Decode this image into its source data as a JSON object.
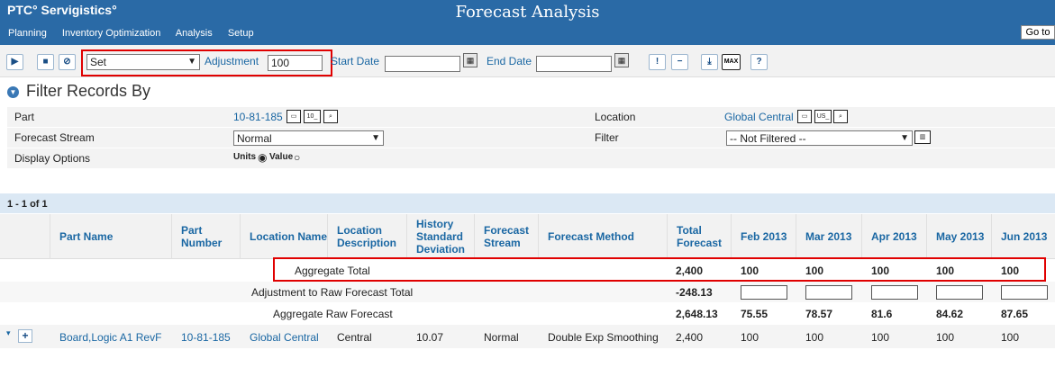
{
  "header": {
    "logo": "PTC° Servigistics°",
    "title": "Forecast Analysis",
    "menu": [
      "Planning",
      "Inventory Optimization",
      "Analysis",
      "Setup"
    ],
    "goto_label": "Go to"
  },
  "toolbar": {
    "mode_value": "Set",
    "adjustment_label": "Adjustment",
    "adjustment_value": "100",
    "start_date_label": "Start Date",
    "start_date_value": "",
    "end_date_label": "End Date",
    "end_date_value": "",
    "max_label": "MAX",
    "help_label": "?"
  },
  "filter": {
    "title": "Filter Records By",
    "part_label": "Part",
    "part_value": "10-81-185",
    "part_icon_text": "10_",
    "location_label": "Location",
    "location_value": "Global Central",
    "location_icon_text": "US_",
    "forecast_stream_label": "Forecast Stream",
    "forecast_stream_value": "Normal",
    "filter_label": "Filter",
    "filter_value": "-- Not Filtered --",
    "display_options_label": "Display Options",
    "units_label": "Units",
    "value_label": "Value"
  },
  "grid": {
    "count": "1 - 1 of 1",
    "columns": [
      "Part Name",
      "Part Number",
      "Location Name",
      "Location Description",
      "History Standard Deviation",
      "Forecast Stream",
      "Forecast Method",
      "Total Forecast",
      "Feb 2013",
      "Mar 2013",
      "Apr 2013",
      "May 2013",
      "Jun 2013"
    ],
    "aggregate": {
      "label": "Aggregate Total",
      "total": "2,400",
      "months": [
        "100",
        "100",
        "100",
        "100",
        "100"
      ]
    },
    "adjustment": {
      "label": "Adjustment to Raw Forecast Total",
      "total": "-248.13"
    },
    "raw": {
      "label": "Aggregate Raw Forecast",
      "total": "2,648.13",
      "months": [
        "75.55",
        "78.57",
        "81.6",
        "84.62",
        "87.65"
      ]
    },
    "rows": [
      {
        "part_name": "Board,Logic A1 RevF",
        "part_number": "10-81-185",
        "location_name": "Global Central",
        "location_desc": "Central",
        "history_std": "10.07",
        "stream": "Normal",
        "method": "Double Exp Smoothing",
        "total": "2,400",
        "months": [
          "100",
          "100",
          "100",
          "100",
          "100"
        ]
      }
    ]
  }
}
